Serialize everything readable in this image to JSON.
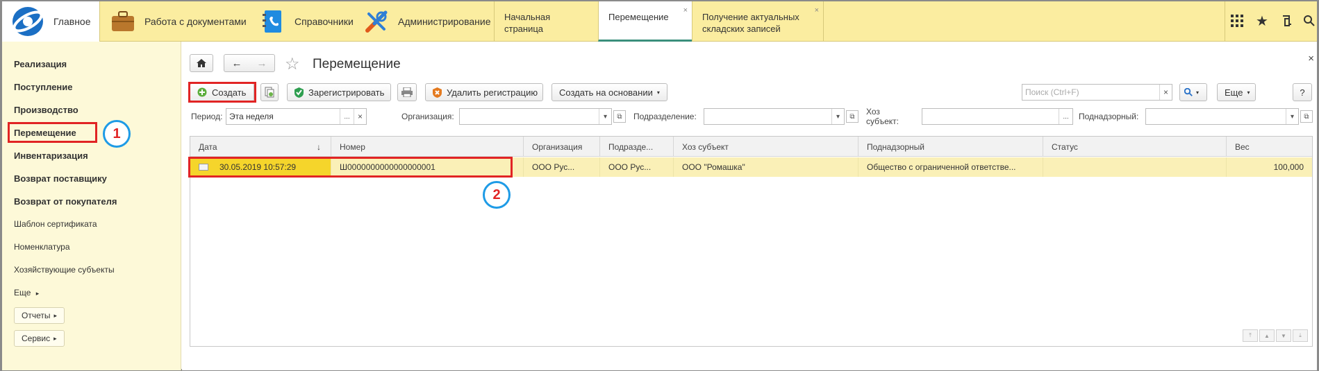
{
  "sections": {
    "main": "Главное",
    "documents": "Работа с документами",
    "references": "Справочники",
    "admin": "Администрирование"
  },
  "tabs": [
    {
      "label": "Начальная страница"
    },
    {
      "label": "Перемещение",
      "close": "×"
    },
    {
      "label": "Получение актуальных складских записей",
      "close": "×"
    }
  ],
  "sidebar": {
    "items": [
      {
        "label": "Реализация"
      },
      {
        "label": "Поступление"
      },
      {
        "label": "Производство"
      },
      {
        "label": "Перемещение"
      },
      {
        "label": "Инвентаризация"
      },
      {
        "label": "Возврат поставщику"
      },
      {
        "label": "Возврат от покупателя"
      },
      {
        "label": "Шаблон сертификата"
      },
      {
        "label": "Номенклатура"
      },
      {
        "label": "Хозяйствующие субъекты"
      },
      {
        "label": "Еще"
      }
    ],
    "reports_btn": "Отчеты",
    "service_btn": "Сервис",
    "more_arrow": "▸"
  },
  "annotations": {
    "one": "1",
    "two": "2"
  },
  "form": {
    "title": "Перемещение",
    "close": "×",
    "toolbar": {
      "create": "Создать",
      "register": "Зарегистрировать",
      "delete_reg": "Удалить регистрацию",
      "create_based": "Создать на основании",
      "search_placeholder": "Поиск (Ctrl+F)",
      "more": "Еще",
      "help": "?"
    },
    "filters": {
      "period_label": "Период:",
      "period_value": "Эта неделя",
      "org_label": "Организация:",
      "dept_label": "Подразделение:",
      "subject_label": "Хоз субъект:",
      "supervised_label": "Поднадзорный:"
    },
    "columns": [
      "Дата",
      "Номер",
      "Организация",
      "Подразде...",
      "Хоз субъект",
      "Поднадзорный",
      "Статус",
      "Вес"
    ],
    "sort_arrow": "↓",
    "rows": [
      {
        "date": "30.05.2019 10:57:29",
        "number": "Ш0000000000000000001",
        "org": "ООО Рус...",
        "dept": "ООО Рус...",
        "subject": "ООО \"Ромашка\"",
        "supervised": "Общество с ограниченной ответстве...",
        "status": "",
        "weight": "100,000"
      }
    ]
  },
  "colors": {
    "topbar": "#fbeda0",
    "sidebar": "#fdf9d8",
    "row_selected": "#faf0b7",
    "cell_selected": "#f5d52b",
    "annotation_red": "#e12424",
    "annotation_blue": "#1e9be6"
  }
}
